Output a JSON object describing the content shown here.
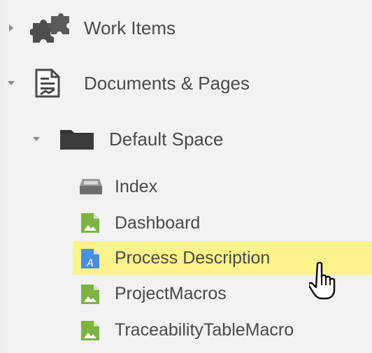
{
  "tree": {
    "work_items": {
      "label": "Work Items",
      "icon": "puzzle-icon",
      "expanded": false
    },
    "documents_pages": {
      "label": "Documents & Pages",
      "icon": "document-icon",
      "expanded": true
    },
    "default_space": {
      "label": "Default Space",
      "icon": "folder-icon",
      "expanded": true
    },
    "items": [
      {
        "label": "Index",
        "icon": "index-tray-icon",
        "selected": false
      },
      {
        "label": "Dashboard",
        "icon": "page-icon",
        "selected": false
      },
      {
        "label": "Process Description",
        "icon": "document-page-icon",
        "selected": true
      },
      {
        "label": "ProjectMacros",
        "icon": "page-icon",
        "selected": false
      },
      {
        "label": "TraceabilityTableMacro",
        "icon": "page-icon",
        "selected": false
      }
    ]
  },
  "colors": {
    "selection": "#fbf38b",
    "page_icon_green": "#7cb342",
    "doc_icon_blue": "#4a90d9",
    "icon_dark": "#444444"
  }
}
